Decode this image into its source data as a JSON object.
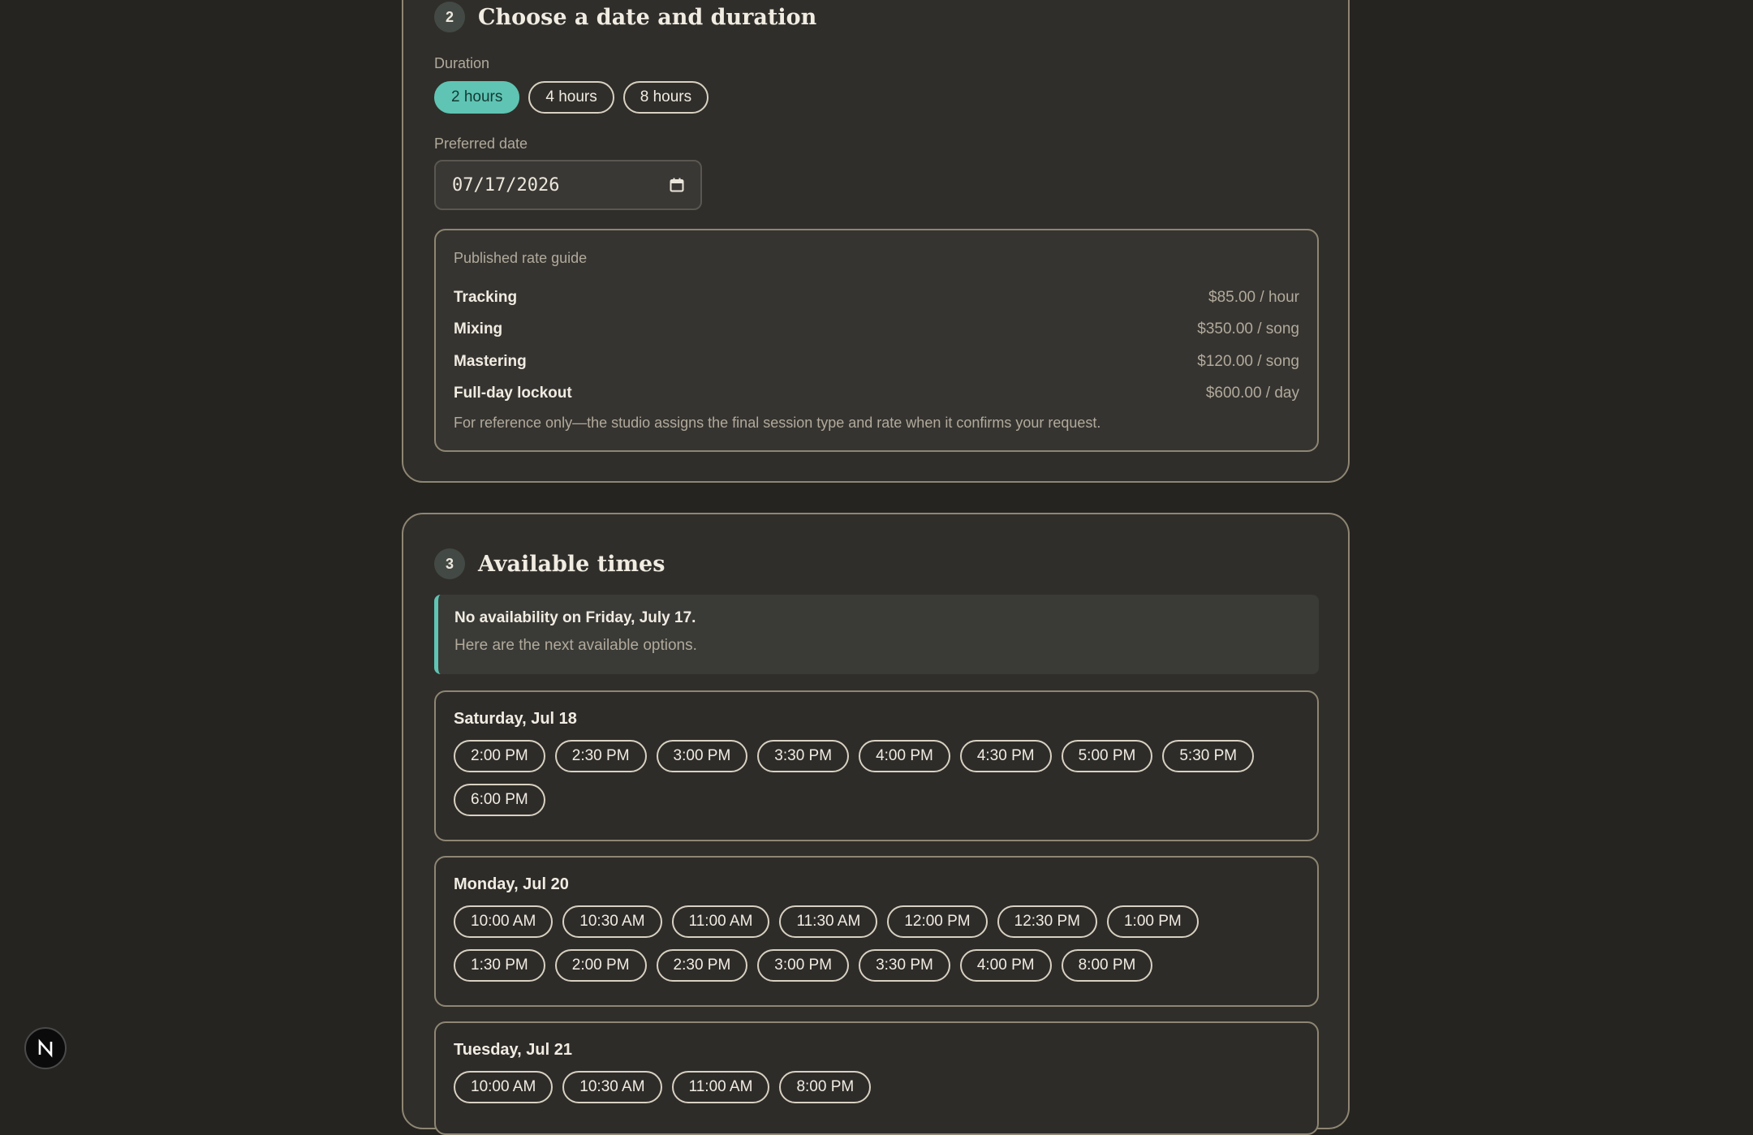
{
  "step2": {
    "number": "2",
    "title": "Choose a date and duration",
    "duration_label": "Duration",
    "durations": [
      {
        "label": "2 hours",
        "selected": true
      },
      {
        "label": "4 hours",
        "selected": false
      },
      {
        "label": "8 hours",
        "selected": false
      }
    ],
    "date_label": "Preferred date",
    "date_value": "07/17/2026",
    "rate_guide": {
      "title": "Published rate guide",
      "rows": [
        {
          "name": "Tracking",
          "price": "$85.00 / hour"
        },
        {
          "name": "Mixing",
          "price": "$350.00 / song"
        },
        {
          "name": "Mastering",
          "price": "$120.00 / song"
        },
        {
          "name": "Full-day lockout",
          "price": "$600.00 / day"
        }
      ],
      "note": "For reference only—the studio assigns the final session type and rate when it confirms your request."
    }
  },
  "step3": {
    "number": "3",
    "title": "Available times",
    "notice_title": "No availability on Friday, July 17.",
    "notice_sub": "Here are the next available options.",
    "days": [
      {
        "label": "Saturday, Jul 18",
        "slots": [
          "2:00 PM",
          "2:30 PM",
          "3:00 PM",
          "3:30 PM",
          "4:00 PM",
          "4:30 PM",
          "5:00 PM",
          "5:30 PM",
          "6:00 PM"
        ]
      },
      {
        "label": "Monday, Jul 20",
        "slots": [
          "10:00 AM",
          "10:30 AM",
          "11:00 AM",
          "11:30 AM",
          "12:00 PM",
          "12:30 PM",
          "1:00 PM",
          "1:30 PM",
          "2:00 PM",
          "2:30 PM",
          "3:00 PM",
          "3:30 PM",
          "4:00 PM",
          "8:00 PM"
        ]
      },
      {
        "label": "Tuesday, Jul 21",
        "slots": [
          "10:00 AM",
          "10:30 AM",
          "11:00 AM",
          "8:00 PM"
        ]
      }
    ]
  },
  "colors": {
    "accent": "#5fc4b3",
    "background": "#252421",
    "card": "#302e2a",
    "border": "#8e8673"
  },
  "fab": {
    "icon": "n-logo-icon"
  }
}
